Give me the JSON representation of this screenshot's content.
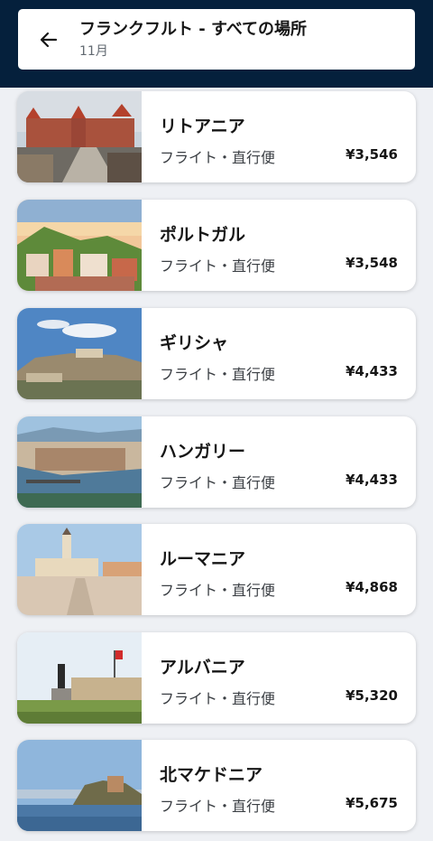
{
  "header": {
    "title": "フランクフルト - すべての場所",
    "subtitle": "11月"
  },
  "destinations": [
    {
      "name": "リトアニア",
      "flight": "フライト・直行便",
      "price": "¥3,546",
      "image": "castle-bridge"
    },
    {
      "name": "ポルトガル",
      "flight": "フライト・直行便",
      "price": "¥3,548",
      "image": "hillside-city"
    },
    {
      "name": "ギリシャ",
      "flight": "フライト・直行便",
      "price": "¥4,433",
      "image": "acropolis"
    },
    {
      "name": "ハンガリー",
      "flight": "フライト・直行便",
      "price": "¥4,433",
      "image": "river-city"
    },
    {
      "name": "ルーマニア",
      "flight": "フライト・直行便",
      "price": "¥4,868",
      "image": "town-square"
    },
    {
      "name": "アルバニア",
      "flight": "フライト・直行便",
      "price": "¥5,320",
      "image": "statue-square"
    },
    {
      "name": "北マケドニア",
      "flight": "フライト・直行便",
      "price": "¥5,675",
      "image": "lake-church"
    }
  ]
}
